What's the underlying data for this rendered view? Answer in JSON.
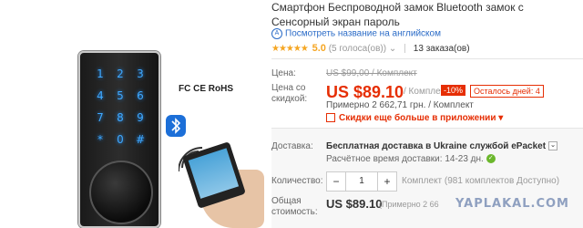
{
  "product": {
    "title": "Смартфон Беспроводной замок Bluetooth замок с Сенсорный экран пароль",
    "translate_link": "Посмотреть название на английском",
    "rating": {
      "score": "5.0",
      "votes": "(5 голоса(ов))",
      "orders": "13 заказа(ов)",
      "stars": "★★★★★"
    }
  },
  "image": {
    "keypad_keys": [
      "1",
      "2",
      "3",
      "4",
      "5",
      "6",
      "7",
      "8",
      "9",
      "*",
      "0",
      "#"
    ],
    "certifications": "FC  CE  RoHS",
    "bluetooth_glyph": "ʙ"
  },
  "pricing": {
    "price_label": "Цена:",
    "old_price": "US $99,00 / Комплект",
    "discount_label": "Цена со скидкой:",
    "price": "US $89.10",
    "per_unit": "/ Комплект",
    "discount_badge": "-10%",
    "days_left": "Осталось дней: 4",
    "approx": "Примерно 2 662,71 грн. / Комплект",
    "app_deal": "Скидки еще больше в приложении"
  },
  "shipping": {
    "label": "Доставка:",
    "method": "Бесплатная доставка в Ukraine службой ePacket",
    "eta": "Расчётное время доставки: 14-23 дн."
  },
  "quantity": {
    "label": "Количество:",
    "minus": "−",
    "value": "1",
    "plus": "+",
    "note": "Комплект (981 комплектов Доступно)"
  },
  "total": {
    "label": "Общая стоимость:",
    "value": "US $89.10",
    "approx": "(Примерно 2 66"
  },
  "watermark": "YAPLAKAL.COM",
  "colors": {
    "accent": "#e62e04",
    "link": "#2a6bc7",
    "star": "#f5a623"
  }
}
